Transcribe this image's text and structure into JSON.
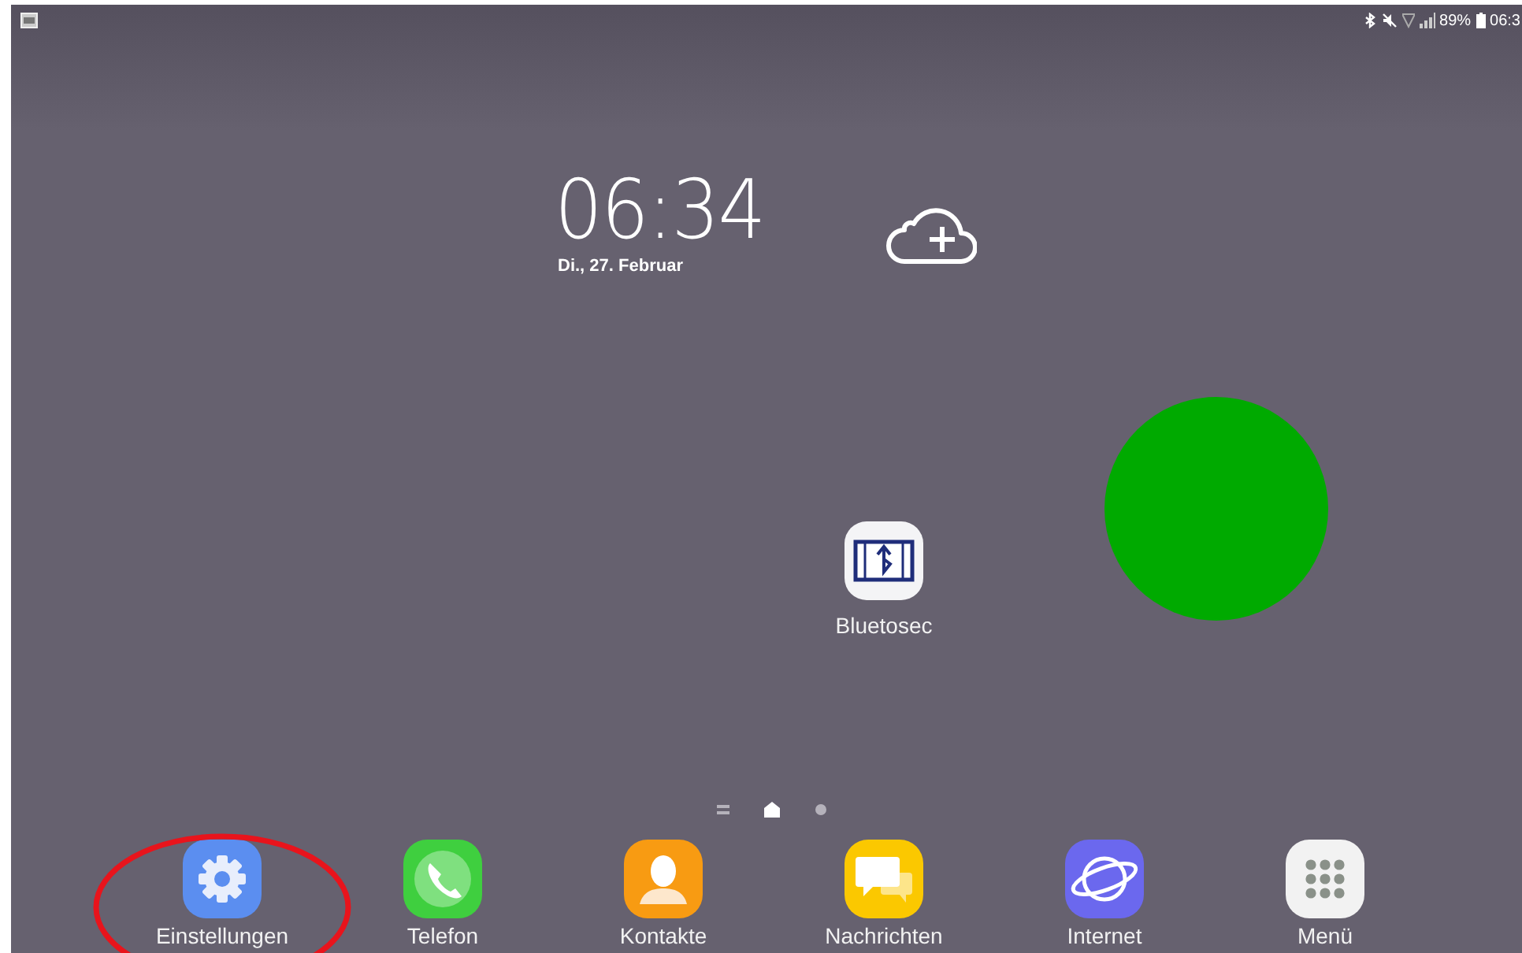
{
  "status_bar": {
    "battery": "89%",
    "time": "06:3"
  },
  "clock": {
    "time": "06:34",
    "date": "Di., 27. Februar"
  },
  "desktop_apps": [
    {
      "label": "Bluetosec",
      "kind": "bluetosec"
    }
  ],
  "page_indicators": [
    {
      "kind": "list",
      "selected": false
    },
    {
      "kind": "home",
      "selected": true
    },
    {
      "kind": "dot",
      "selected": false
    }
  ],
  "dock": [
    {
      "label": "Einstellungen",
      "kind": "settings"
    },
    {
      "label": "Telefon",
      "kind": "phone"
    },
    {
      "label": "Kontakte",
      "kind": "contacts"
    },
    {
      "label": "Nachrichten",
      "kind": "messages"
    },
    {
      "label": "Internet",
      "kind": "internet"
    },
    {
      "label": "Menü",
      "kind": "apps"
    }
  ]
}
